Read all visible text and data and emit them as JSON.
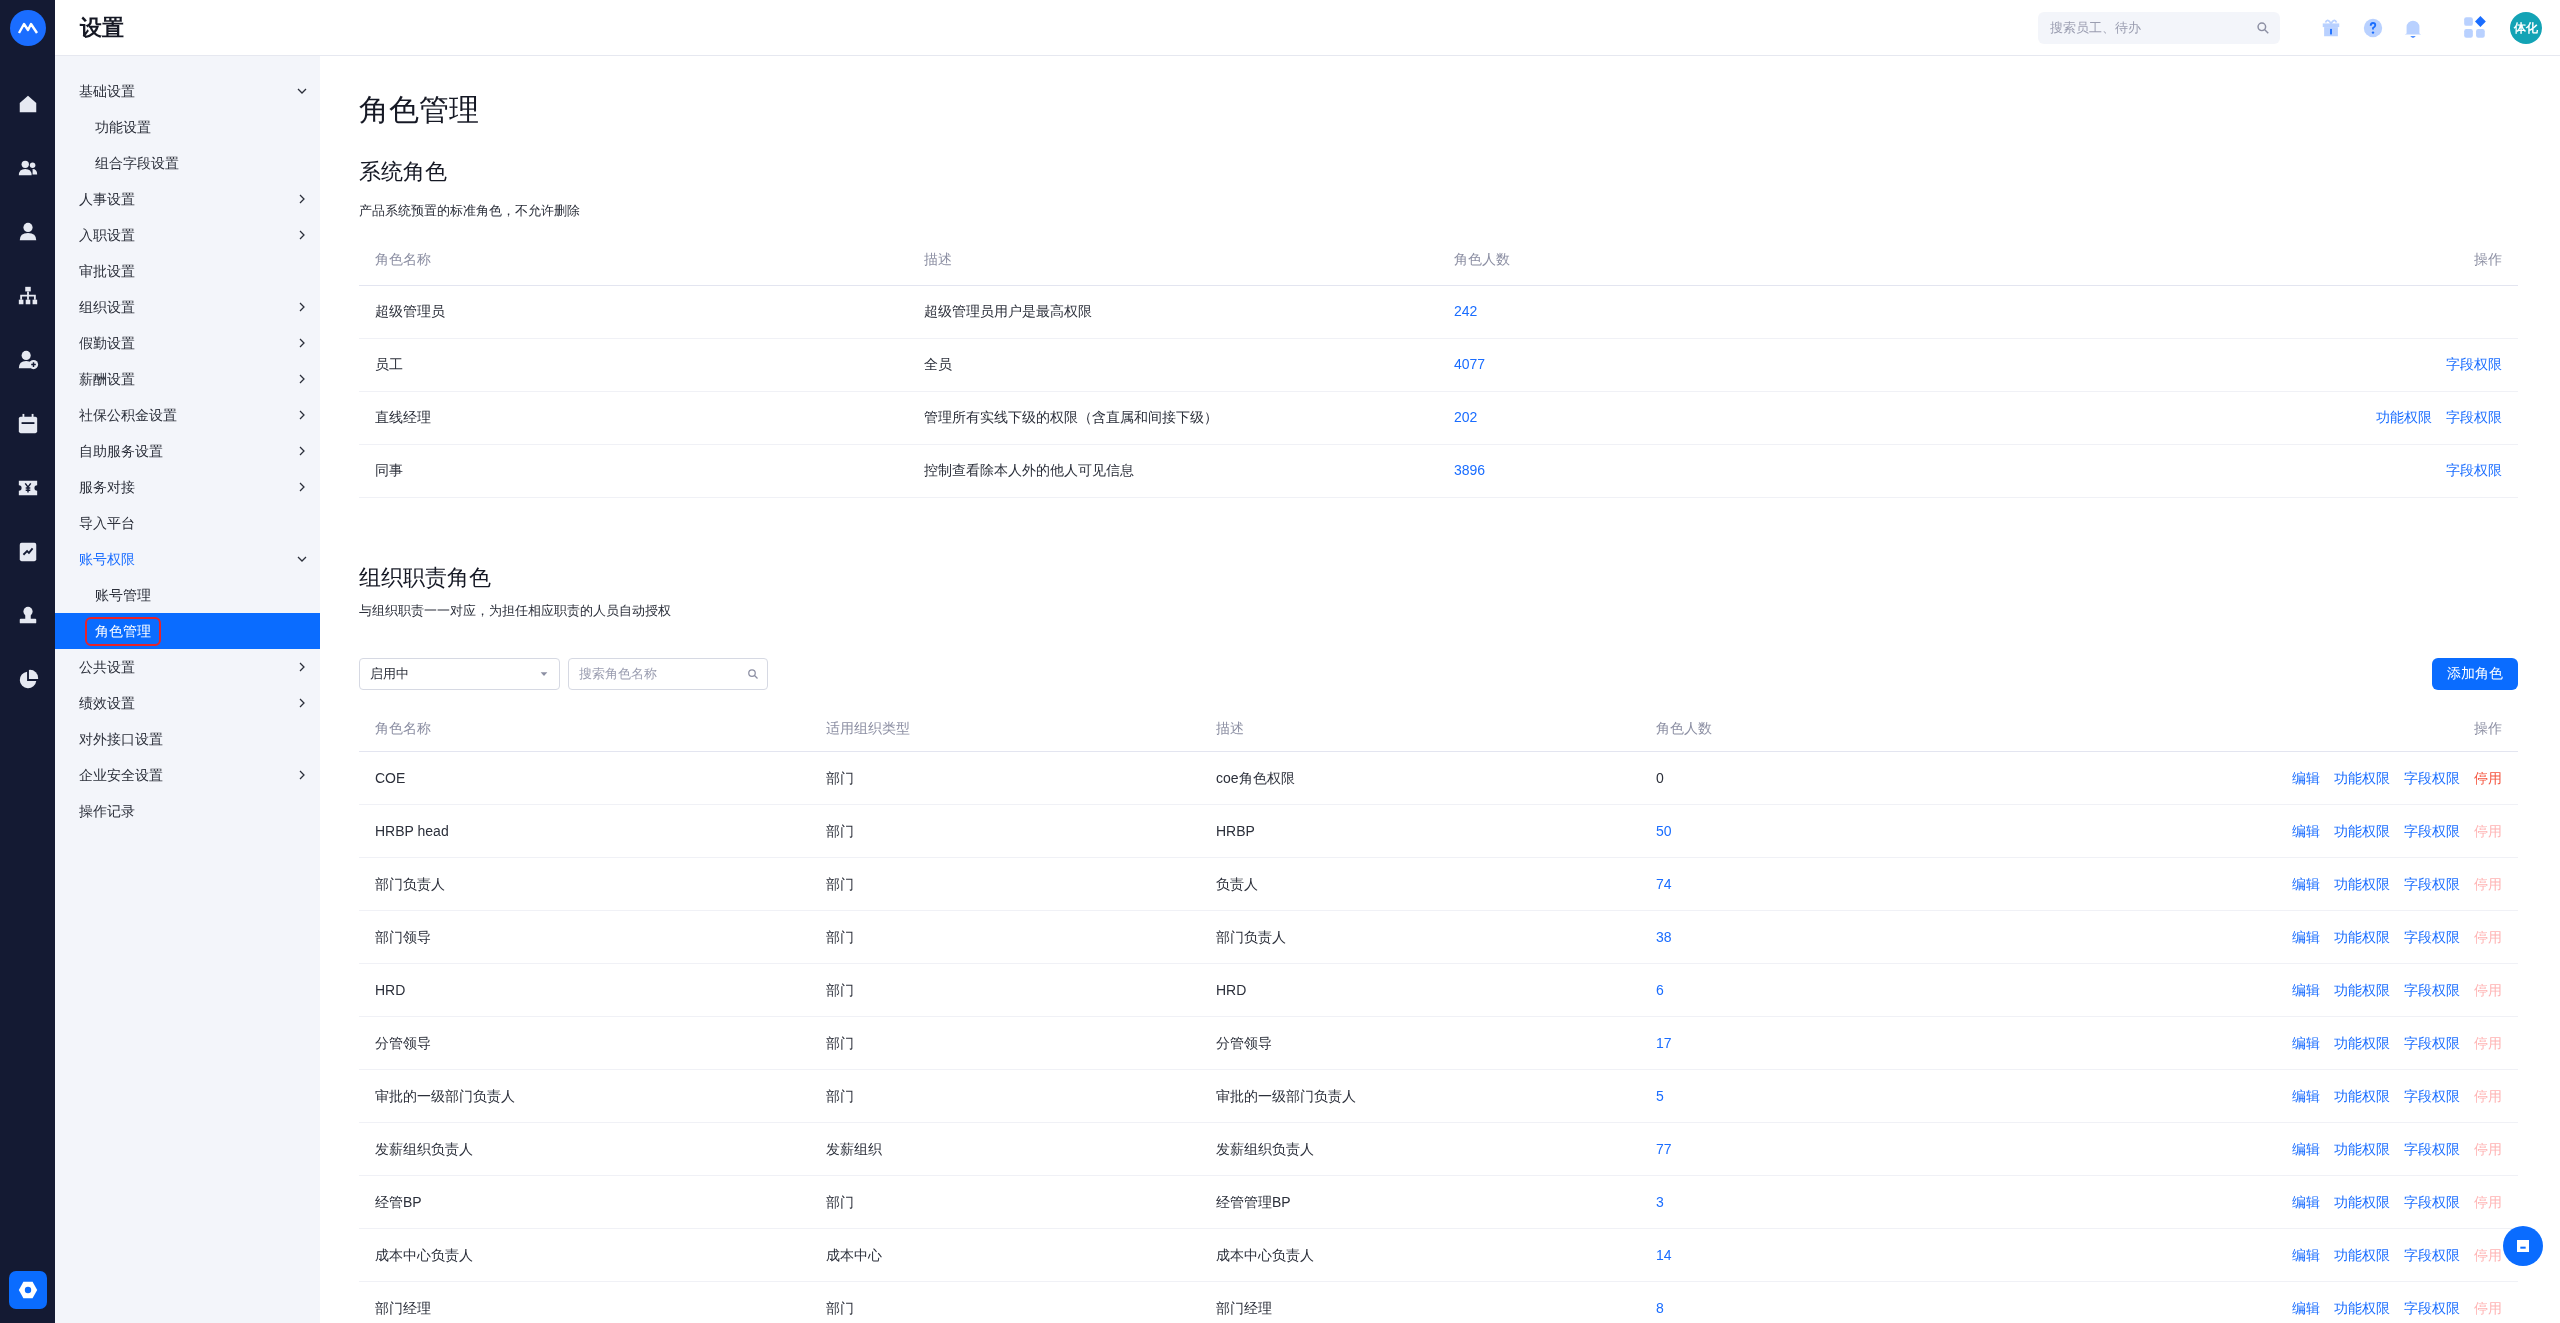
{
  "header": {
    "title": "设置",
    "search": {
      "placeholder": "搜索员工、待办"
    },
    "avatar": "体化"
  },
  "sidebar": {
    "items": [
      {
        "label": "基础设置",
        "kind": "group",
        "expanded": true,
        "selected": false,
        "children": [
          {
            "label": "功能设置",
            "selected": false,
            "outlined": false
          },
          {
            "label": "组合字段设置",
            "selected": false,
            "outlined": false
          }
        ]
      },
      {
        "label": "人事设置",
        "kind": "group",
        "expanded": false,
        "selected": false
      },
      {
        "label": "入职设置",
        "kind": "group",
        "expanded": false,
        "selected": false
      },
      {
        "label": "审批设置",
        "kind": "link",
        "selected": false
      },
      {
        "label": "组织设置",
        "kind": "group",
        "expanded": false,
        "selected": false
      },
      {
        "label": "假勤设置",
        "kind": "group",
        "expanded": false,
        "selected": false
      },
      {
        "label": "薪酬设置",
        "kind": "group",
        "expanded": false,
        "selected": false
      },
      {
        "label": "社保公积金设置",
        "kind": "group",
        "expanded": false,
        "selected": false
      },
      {
        "label": "自助服务设置",
        "kind": "group",
        "expanded": false,
        "selected": false
      },
      {
        "label": "服务对接",
        "kind": "group",
        "expanded": false,
        "selected": false
      },
      {
        "label": "导入平台",
        "kind": "link",
        "selected": false
      },
      {
        "label": "账号权限",
        "kind": "group",
        "expanded": true,
        "selected": false,
        "children": [
          {
            "label": "账号管理",
            "selected": false,
            "outlined": false
          },
          {
            "label": "角色管理",
            "selected": true,
            "outlined": true
          }
        ]
      },
      {
        "label": "公共设置",
        "kind": "group",
        "expanded": false,
        "selected": false
      },
      {
        "label": "绩效设置",
        "kind": "group",
        "expanded": false,
        "selected": false
      },
      {
        "label": "对外接口设置",
        "kind": "link",
        "selected": false
      },
      {
        "label": "企业安全设置",
        "kind": "group",
        "expanded": false,
        "selected": false
      },
      {
        "label": "操作记录",
        "kind": "link",
        "selected": false
      }
    ]
  },
  "page_title": "角色管理",
  "system_roles": {
    "title": "系统角色",
    "description": "产品系统预置的标准角色，不允许删除",
    "columns": [
      "角色名称",
      "描述",
      "角色人数",
      "操作"
    ],
    "rows": [
      {
        "name": "超级管理员",
        "description": "超级管理员用户是最高权限",
        "count": "242",
        "actions": []
      },
      {
        "name": "员工",
        "description": "全员",
        "count": "4077",
        "actions": [
          "字段权限"
        ]
      },
      {
        "name": "直线经理",
        "description": "管理所有实线下级的权限（含直属和间接下级）",
        "count": "202",
        "actions": [
          "功能权限",
          "字段权限"
        ]
      },
      {
        "name": "同事",
        "description": "控制查看除本人外的他人可见信息",
        "count": "3896",
        "actions": [
          "字段权限"
        ]
      }
    ]
  },
  "org_roles": {
    "title": "组织职责角色",
    "description": "与组织职责一一对应，为担任相应职责的人员自动授权",
    "status_filter": "启用中",
    "search": {
      "placeholder": "搜索角色名称"
    },
    "add_button": "添加角色",
    "columns": [
      "角色名称",
      "适用组织类型",
      "描述",
      "角色人数",
      "操作"
    ],
    "rows": [
      {
        "name": "COE",
        "org_type": "部门",
        "description": "coe角色权限",
        "count": "0",
        "count_link": false,
        "actions": [
          "编辑",
          "功能权限",
          "字段权限"
        ],
        "stop": "停用",
        "stop_disabled": false
      },
      {
        "name": "HRBP head",
        "org_type": "部门",
        "description": "HRBP",
        "count": "50",
        "count_link": true,
        "actions": [
          "编辑",
          "功能权限",
          "字段权限"
        ],
        "stop": "停用",
        "stop_disabled": true
      },
      {
        "name": "部门负责人",
        "org_type": "部门",
        "description": "负责人",
        "count": "74",
        "count_link": true,
        "actions": [
          "编辑",
          "功能权限",
          "字段权限"
        ],
        "stop": "停用",
        "stop_disabled": true
      },
      {
        "name": "部门领导",
        "org_type": "部门",
        "description": "部门负责人",
        "count": "38",
        "count_link": true,
        "actions": [
          "编辑",
          "功能权限",
          "字段权限"
        ],
        "stop": "停用",
        "stop_disabled": true
      },
      {
        "name": "HRD",
        "org_type": "部门",
        "description": "HRD",
        "count": "6",
        "count_link": true,
        "actions": [
          "编辑",
          "功能权限",
          "字段权限"
        ],
        "stop": "停用",
        "stop_disabled": true
      },
      {
        "name": "分管领导",
        "org_type": "部门",
        "description": "分管领导",
        "count": "17",
        "count_link": true,
        "actions": [
          "编辑",
          "功能权限",
          "字段权限"
        ],
        "stop": "停用",
        "stop_disabled": true
      },
      {
        "name": "审批的一级部门负责人",
        "org_type": "部门",
        "description": "审批的一级部门负责人",
        "count": "5",
        "count_link": true,
        "actions": [
          "编辑",
          "功能权限",
          "字段权限"
        ],
        "stop": "停用",
        "stop_disabled": true
      },
      {
        "name": "发薪组织负责人",
        "org_type": "发薪组织",
        "description": "发薪组织负责人",
        "count": "77",
        "count_link": true,
        "actions": [
          "编辑",
          "功能权限",
          "字段权限"
        ],
        "stop": "停用",
        "stop_disabled": true
      },
      {
        "name": "经管BP",
        "org_type": "部门",
        "description": "经管管理BP",
        "count": "3",
        "count_link": true,
        "actions": [
          "编辑",
          "功能权限",
          "字段权限"
        ],
        "stop": "停用",
        "stop_disabled": true
      },
      {
        "name": "成本中心负责人",
        "org_type": "成本中心",
        "description": "成本中心负责人",
        "count": "14",
        "count_link": true,
        "actions": [
          "编辑",
          "功能权限",
          "字段权限"
        ],
        "stop": "停用",
        "stop_disabled": true
      },
      {
        "name": "部门经理",
        "org_type": "部门",
        "description": "部门经理",
        "count": "8",
        "count_link": true,
        "actions": [
          "编辑",
          "功能权限",
          "字段权限"
        ],
        "stop": "停用",
        "stop_disabled": true
      }
    ]
  }
}
